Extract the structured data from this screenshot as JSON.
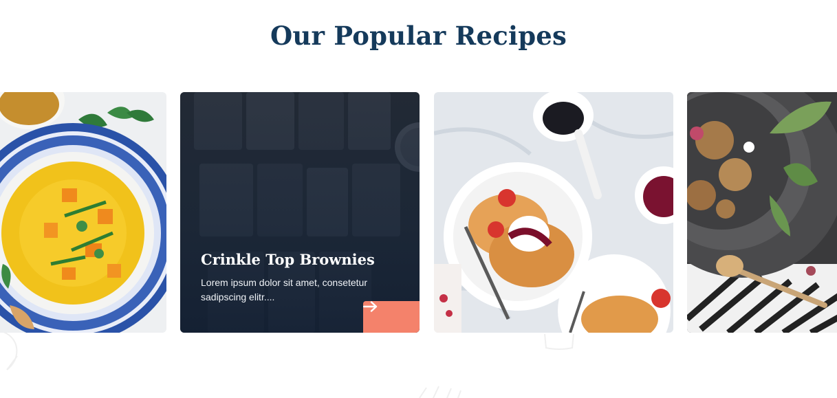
{
  "section": {
    "title": "Our Popular Recipes"
  },
  "recipes": [
    {
      "image": "curry-bowl-image"
    },
    {
      "title": "Crinkle Top Brownies",
      "description": "Lorem ipsum dolor sit amet, consetetur sadipscing elitr....",
      "image": "brownies-image",
      "action_icon": "arrow-right-icon"
    },
    {
      "image": "pancakes-image"
    },
    {
      "image": "granola-bowl-image"
    }
  ],
  "colors": {
    "title": "#153a5b",
    "accent": "#f4826b",
    "overlay": "#14263e"
  }
}
